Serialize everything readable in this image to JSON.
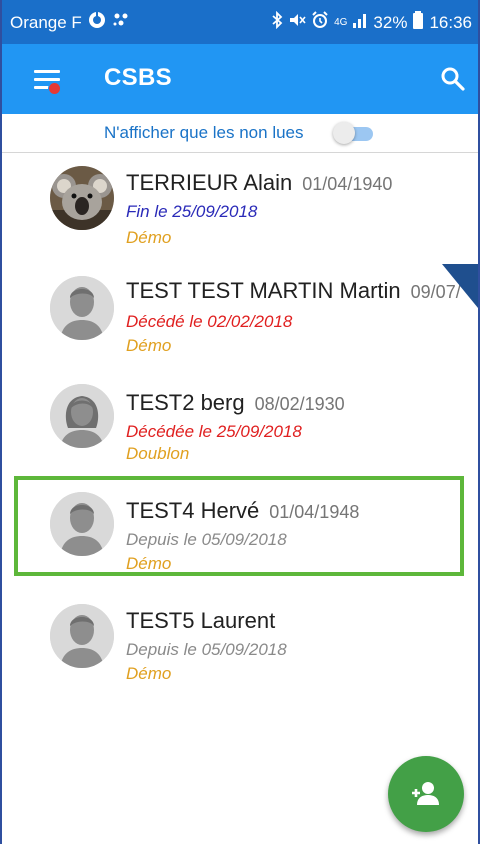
{
  "status_bar": {
    "carrier": "Orange F",
    "network": "4G",
    "battery": "32%",
    "time": "16:36"
  },
  "app_bar": {
    "title": "CSBS",
    "menu_icon": "menu-icon",
    "search_icon": "search-icon",
    "notification_dot_color": "#e53935"
  },
  "filter": {
    "label": "N'afficher que les non lues",
    "toggle_on": false
  },
  "colors": {
    "primary": "#2196f3",
    "status_bar": "#1a6fc9",
    "fin": "#2a2ab8",
    "deceased": "#e02020",
    "depuis": "#8a8a8a",
    "tag": "#e0a020",
    "selected_border": "#5db73a",
    "fab": "#43a047"
  },
  "patients": [
    {
      "name": "TERRIEUR Alain",
      "birth_date": "01/04/1940",
      "status": "Fin le 25/09/2018",
      "status_type": "fin",
      "tag": "Démo",
      "avatar": "koala-photo",
      "selected": false
    },
    {
      "name": "TEST TEST MARTIN Martin",
      "birth_date": "09/07/",
      "status": "Décédé le 02/02/2018",
      "status_type": "deceased",
      "tag": "Démo",
      "avatar": "male-avatar",
      "selected": false
    },
    {
      "name": "TEST2 berg",
      "birth_date": "08/02/1930",
      "status": "Décédée le 25/09/2018",
      "status_type": "deceased",
      "tag": "Doublon",
      "avatar": "female-avatar",
      "selected": false
    },
    {
      "name": "TEST4 Hervé",
      "birth_date": "01/04/1948",
      "status": "Depuis le 05/09/2018",
      "status_type": "depuis",
      "tag": "Démo",
      "avatar": "male-avatar",
      "selected": true
    },
    {
      "name": "TEST5 Laurent",
      "birth_date": "",
      "status": "Depuis le 05/09/2018",
      "status_type": "depuis",
      "tag": "Démo",
      "avatar": "male-avatar",
      "selected": false
    }
  ],
  "fab": {
    "icon": "add-person-icon"
  }
}
